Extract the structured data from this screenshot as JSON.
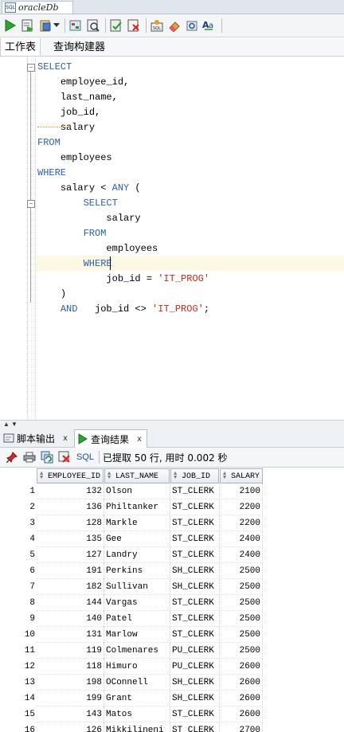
{
  "document_tab": {
    "label": "oracleDb",
    "icon": "sql-file-icon"
  },
  "toolbar": {
    "buttons": [
      "run-statement-icon",
      "run-script-icon",
      "commit-icon",
      "dropdown-icon",
      "rollback-icon",
      "explain-plan-icon",
      "autotrace-icon",
      "sql-tuning-icon",
      "clear-icon",
      "sql-history-icon",
      "format-icon",
      "unshared-worksheet-icon"
    ]
  },
  "editor_tabs": {
    "worksheet": "工作表",
    "query_builder": "查询构建器"
  },
  "editor": {
    "lines": [
      {
        "indent": "",
        "parts": [
          {
            "t": "SELECT",
            "k": "kw"
          }
        ]
      },
      {
        "indent": "    ",
        "parts": [
          {
            "t": "employee_id,",
            "k": ""
          }
        ]
      },
      {
        "indent": "    ",
        "parts": [
          {
            "t": "last_name,",
            "k": ""
          }
        ]
      },
      {
        "indent": "    ",
        "parts": [
          {
            "t": "job_id,",
            "k": ""
          }
        ]
      },
      {
        "indent": "    ",
        "parts": [
          {
            "t": "salary",
            "k": ""
          }
        ]
      },
      {
        "indent": "",
        "parts": [
          {
            "t": "FROM",
            "k": "kw"
          }
        ]
      },
      {
        "indent": "    ",
        "parts": [
          {
            "t": "employees",
            "k": ""
          }
        ]
      },
      {
        "indent": "",
        "parts": [
          {
            "t": "WHERE",
            "k": "kw"
          }
        ]
      },
      {
        "indent": "    ",
        "parts": [
          {
            "t": "salary < ",
            "k": ""
          },
          {
            "t": "ANY",
            "k": "kw"
          },
          {
            "t": " (",
            "k": ""
          }
        ]
      },
      {
        "indent": "        ",
        "parts": [
          {
            "t": "SELECT",
            "k": "kw"
          }
        ]
      },
      {
        "indent": "            ",
        "parts": [
          {
            "t": "salary",
            "k": ""
          }
        ]
      },
      {
        "indent": "        ",
        "parts": [
          {
            "t": "FROM",
            "k": "kw"
          }
        ]
      },
      {
        "indent": "            ",
        "parts": [
          {
            "t": "employees",
            "k": ""
          }
        ]
      },
      {
        "indent": "        ",
        "parts": [
          {
            "t": "WHERE",
            "k": "kw"
          }
        ]
      },
      {
        "indent": "            ",
        "parts": [
          {
            "t": "job_id = ",
            "k": ""
          },
          {
            "t": "'IT_PROG'",
            "k": "str"
          }
        ]
      },
      {
        "indent": "    ",
        "parts": [
          {
            "t": ")",
            "k": ""
          }
        ]
      },
      {
        "indent": "    ",
        "parts": [
          {
            "t": "AND",
            "k": "kw"
          },
          {
            "t": "   job_id <> ",
            "k": ""
          },
          {
            "t": "'IT_PROG'",
            "k": "str"
          },
          {
            "t": ";",
            "k": ""
          }
        ]
      }
    ]
  },
  "bottom_tabs": {
    "script_output": "脚本输出",
    "query_result": "查询结果",
    "close": "x"
  },
  "result_toolbar": {
    "sql_label": "SQL",
    "status": "已提取 50 行, 用时 0.002 秒"
  },
  "result_grid": {
    "columns": [
      "EMPLOYEE_ID",
      "LAST_NAME",
      "JOB_ID",
      "SALARY"
    ],
    "rows": [
      [
        "1",
        "132",
        "Olson",
        "ST_CLERK",
        "2100"
      ],
      [
        "2",
        "136",
        "Philtanker",
        "ST_CLERK",
        "2200"
      ],
      [
        "3",
        "128",
        "Markle",
        "ST_CLERK",
        "2200"
      ],
      [
        "4",
        "135",
        "Gee",
        "ST_CLERK",
        "2400"
      ],
      [
        "5",
        "127",
        "Landry",
        "ST_CLERK",
        "2400"
      ],
      [
        "6",
        "191",
        "Perkins",
        "SH_CLERK",
        "2500"
      ],
      [
        "7",
        "182",
        "Sullivan",
        "SH_CLERK",
        "2500"
      ],
      [
        "8",
        "144",
        "Vargas",
        "ST_CLERK",
        "2500"
      ],
      [
        "9",
        "140",
        "Patel",
        "ST_CLERK",
        "2500"
      ],
      [
        "10",
        "131",
        "Marlow",
        "ST_CLERK",
        "2500"
      ],
      [
        "11",
        "119",
        "Colmenares",
        "PU_CLERK",
        "2500"
      ],
      [
        "12",
        "118",
        "Himuro",
        "PU_CLERK",
        "2600"
      ],
      [
        "13",
        "198",
        "OConnell",
        "SH_CLERK",
        "2600"
      ],
      [
        "14",
        "199",
        "Grant",
        "SH_CLERK",
        "2600"
      ],
      [
        "15",
        "143",
        "Matos",
        "ST_CLERK",
        "2600"
      ],
      [
        "16",
        "126",
        "Mikkilineni",
        "ST_CLERK",
        "2700"
      ]
    ]
  }
}
